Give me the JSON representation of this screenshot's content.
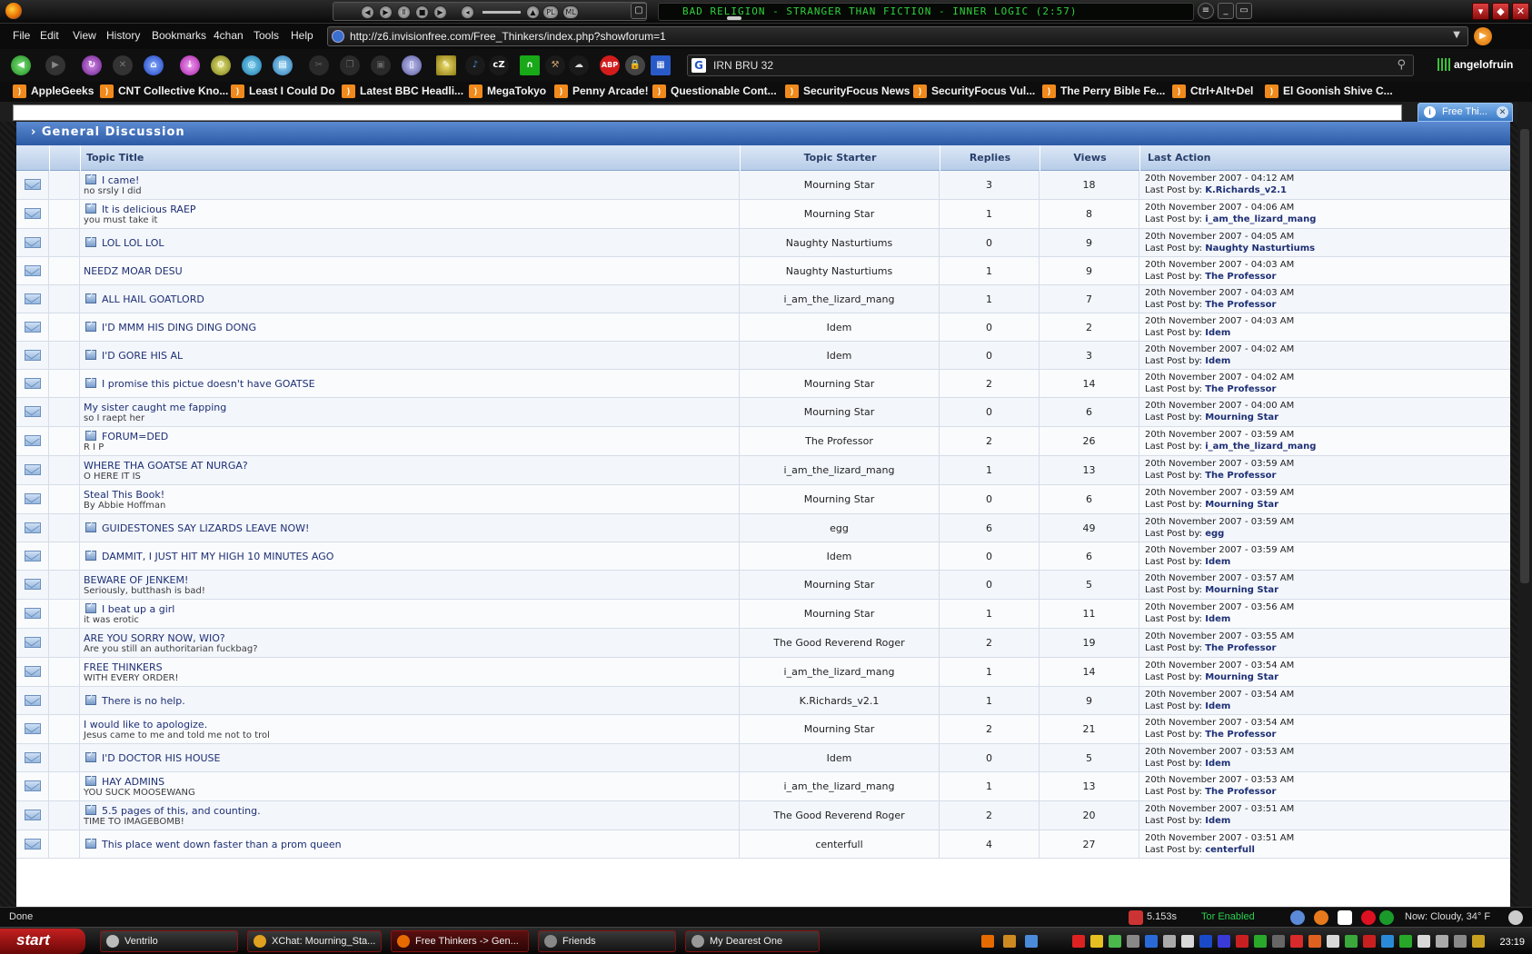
{
  "player": {
    "now_playing": "BAD RELIGION - STRANGER THAN FICTION - INNER LOGIC (2:57)",
    "controls": [
      "prev",
      "play",
      "pause",
      "stop",
      "next"
    ],
    "mode_labels": [
      "PL",
      "ML"
    ]
  },
  "menu": [
    "File",
    "Edit",
    "View",
    "History",
    "Bookmarks",
    "4chan",
    "Tools",
    "Help"
  ],
  "url": "http://z6.invisionfree.com/Free_Thinkers/index.php?showforum=1",
  "toolbar": {
    "cz_label": "cZ",
    "abp_label": "ABP",
    "search_engine_letter": "G",
    "search_value": "IRN BRU 32",
    "username": "angelofruin"
  },
  "bookmarks": [
    "AppleGeeks",
    "CNT Collective Kno...",
    "Least I Could Do",
    "Latest BBC Headli...",
    "MegaTokyo",
    "Penny Arcade!",
    "Questionable Cont...",
    "SecurityFocus News",
    "SecurityFocus Vul...",
    "The Perry Bible Fe...",
    "Ctrl+Alt+Del",
    "El Goonish Shive C..."
  ],
  "tab": {
    "label": "Free Thi...",
    "icon_letter": "i"
  },
  "forum": {
    "section_title": "General Discussion",
    "columns": {
      "title": "Topic Title",
      "starter": "Topic Starter",
      "replies": "Replies",
      "views": "Views",
      "last": "Last Action"
    },
    "last_post_prefix": "Last Post by:",
    "topics": [
      {
        "title": "I came!",
        "desc": "no srsly I did",
        "poll": true,
        "starter": "Mourning Star",
        "replies": "3",
        "views": "18",
        "date": "20th November 2007 - 04:12 AM",
        "last_by": "K.Richards_v2.1"
      },
      {
        "title": "It is delicious RAEP",
        "desc": "you must take it",
        "poll": true,
        "starter": "Mourning Star",
        "replies": "1",
        "views": "8",
        "date": "20th November 2007 - 04:06 AM",
        "last_by": "i_am_the_lizard_mang"
      },
      {
        "title": "LOL LOL LOL",
        "desc": "",
        "poll": true,
        "starter": "Naughty Nasturtiums",
        "replies": "0",
        "views": "9",
        "date": "20th November 2007 - 04:05 AM",
        "last_by": "Naughty Nasturtiums"
      },
      {
        "title": "NEEDZ MOAR DESU",
        "desc": "",
        "poll": false,
        "starter": "Naughty Nasturtiums",
        "replies": "1",
        "views": "9",
        "date": "20th November 2007 - 04:03 AM",
        "last_by": "The Professor"
      },
      {
        "title": "ALL HAIL GOATLORD",
        "desc": "",
        "poll": true,
        "starter": "i_am_the_lizard_mang",
        "replies": "1",
        "views": "7",
        "date": "20th November 2007 - 04:03 AM",
        "last_by": "The Professor"
      },
      {
        "title": "I'D MMM HIS DING DING DONG",
        "desc": "",
        "poll": true,
        "starter": "Idem",
        "replies": "0",
        "views": "2",
        "date": "20th November 2007 - 04:03 AM",
        "last_by": "Idem"
      },
      {
        "title": "I'D GORE HIS AL",
        "desc": "",
        "poll": true,
        "starter": "Idem",
        "replies": "0",
        "views": "3",
        "date": "20th November 2007 - 04:02 AM",
        "last_by": "Idem"
      },
      {
        "title": "I promise this pictue doesn't have GOATSE",
        "desc": "",
        "poll": true,
        "starter": "Mourning Star",
        "replies": "2",
        "views": "14",
        "date": "20th November 2007 - 04:02 AM",
        "last_by": "The Professor"
      },
      {
        "title": "My sister caught me fapping",
        "desc": "so I raept her",
        "poll": false,
        "starter": "Mourning Star",
        "replies": "0",
        "views": "6",
        "date": "20th November 2007 - 04:00 AM",
        "last_by": "Mourning Star"
      },
      {
        "title": "FORUM=DED",
        "desc": "R I P",
        "poll": true,
        "starter": "The Professor",
        "replies": "2",
        "views": "26",
        "date": "20th November 2007 - 03:59 AM",
        "last_by": "i_am_the_lizard_mang"
      },
      {
        "title": "WHERE THA GOATSE AT NURGA?",
        "desc": "O HERE IT IS",
        "poll": false,
        "starter": "i_am_the_lizard_mang",
        "replies": "1",
        "views": "13",
        "date": "20th November 2007 - 03:59 AM",
        "last_by": "The Professor"
      },
      {
        "title": "Steal This Book!",
        "desc": "By Abbie Hoffman",
        "poll": false,
        "starter": "Mourning Star",
        "replies": "0",
        "views": "6",
        "date": "20th November 2007 - 03:59 AM",
        "last_by": "Mourning Star"
      },
      {
        "title": "GUIDESTONES SAY LIZARDS LEAVE NOW!",
        "desc": "",
        "poll": true,
        "starter": "egg",
        "replies": "6",
        "views": "49",
        "date": "20th November 2007 - 03:59 AM",
        "last_by": "egg"
      },
      {
        "title": "DAMMIT, I JUST HIT MY HIGH 10 MINUTES AGO",
        "desc": "",
        "poll": true,
        "starter": "Idem",
        "replies": "0",
        "views": "6",
        "date": "20th November 2007 - 03:59 AM",
        "last_by": "Idem"
      },
      {
        "title": "BEWARE OF JENKEM!",
        "desc": "Seriously, butthash is bad!",
        "poll": false,
        "starter": "Mourning Star",
        "replies": "0",
        "views": "5",
        "date": "20th November 2007 - 03:57 AM",
        "last_by": "Mourning Star"
      },
      {
        "title": "I beat up a girl",
        "desc": "it was erotic",
        "poll": true,
        "starter": "Mourning Star",
        "replies": "1",
        "views": "11",
        "date": "20th November 2007 - 03:56 AM",
        "last_by": "Idem"
      },
      {
        "title": "ARE YOU SORRY NOW, WIO?",
        "desc": "Are you still an authoritarian fuckbag?",
        "poll": false,
        "starter": "The Good Reverend Roger",
        "replies": "2",
        "views": "19",
        "date": "20th November 2007 - 03:55 AM",
        "last_by": "The Professor"
      },
      {
        "title": "FREE THINKERS",
        "desc": "WITH EVERY ORDER!",
        "poll": false,
        "starter": "i_am_the_lizard_mang",
        "replies": "1",
        "views": "14",
        "date": "20th November 2007 - 03:54 AM",
        "last_by": "Mourning Star"
      },
      {
        "title": "There is no help.",
        "desc": "",
        "poll": true,
        "starter": "K.Richards_v2.1",
        "replies": "1",
        "views": "9",
        "date": "20th November 2007 - 03:54 AM",
        "last_by": "Idem"
      },
      {
        "title": "I would like to apologize.",
        "desc": "Jesus came to me and told me not to trol",
        "poll": false,
        "starter": "Mourning Star",
        "replies": "2",
        "views": "21",
        "date": "20th November 2007 - 03:54 AM",
        "last_by": "The Professor"
      },
      {
        "title": "I'D DOCTOR HIS HOUSE",
        "desc": "",
        "poll": true,
        "starter": "Idem",
        "replies": "0",
        "views": "5",
        "date": "20th November 2007 - 03:53 AM",
        "last_by": "Idem"
      },
      {
        "title": "HAY ADMINS",
        "desc": "YOU SUCK MOOSEWANG",
        "poll": true,
        "starter": "i_am_the_lizard_mang",
        "replies": "1",
        "views": "13",
        "date": "20th November 2007 - 03:53 AM",
        "last_by": "The Professor"
      },
      {
        "title": "5.5 pages of this, and counting.",
        "desc": "TIME TO IMAGEBOMB!",
        "poll": true,
        "starter": "The Good Reverend Roger",
        "replies": "2",
        "views": "20",
        "date": "20th November 2007 - 03:51 AM",
        "last_by": "Idem"
      },
      {
        "title": "This place went down faster than a prom queen",
        "desc": "",
        "poll": true,
        "starter": "centerfull",
        "replies": "4",
        "views": "27",
        "date": "20th November 2007 - 03:51 AM",
        "last_by": "centerfull"
      }
    ]
  },
  "status": {
    "text": "Done",
    "timer": "5.153s",
    "tor": "Tor Enabled",
    "weather": "Now: Cloudy, 34° F"
  },
  "taskbar": {
    "start": "start",
    "tasks": [
      "Ventrilo",
      "XChat: Mourning_Sta...",
      "Free Thinkers -> Gen...",
      "Friends",
      "My Dearest One"
    ],
    "clock": "23:19"
  }
}
